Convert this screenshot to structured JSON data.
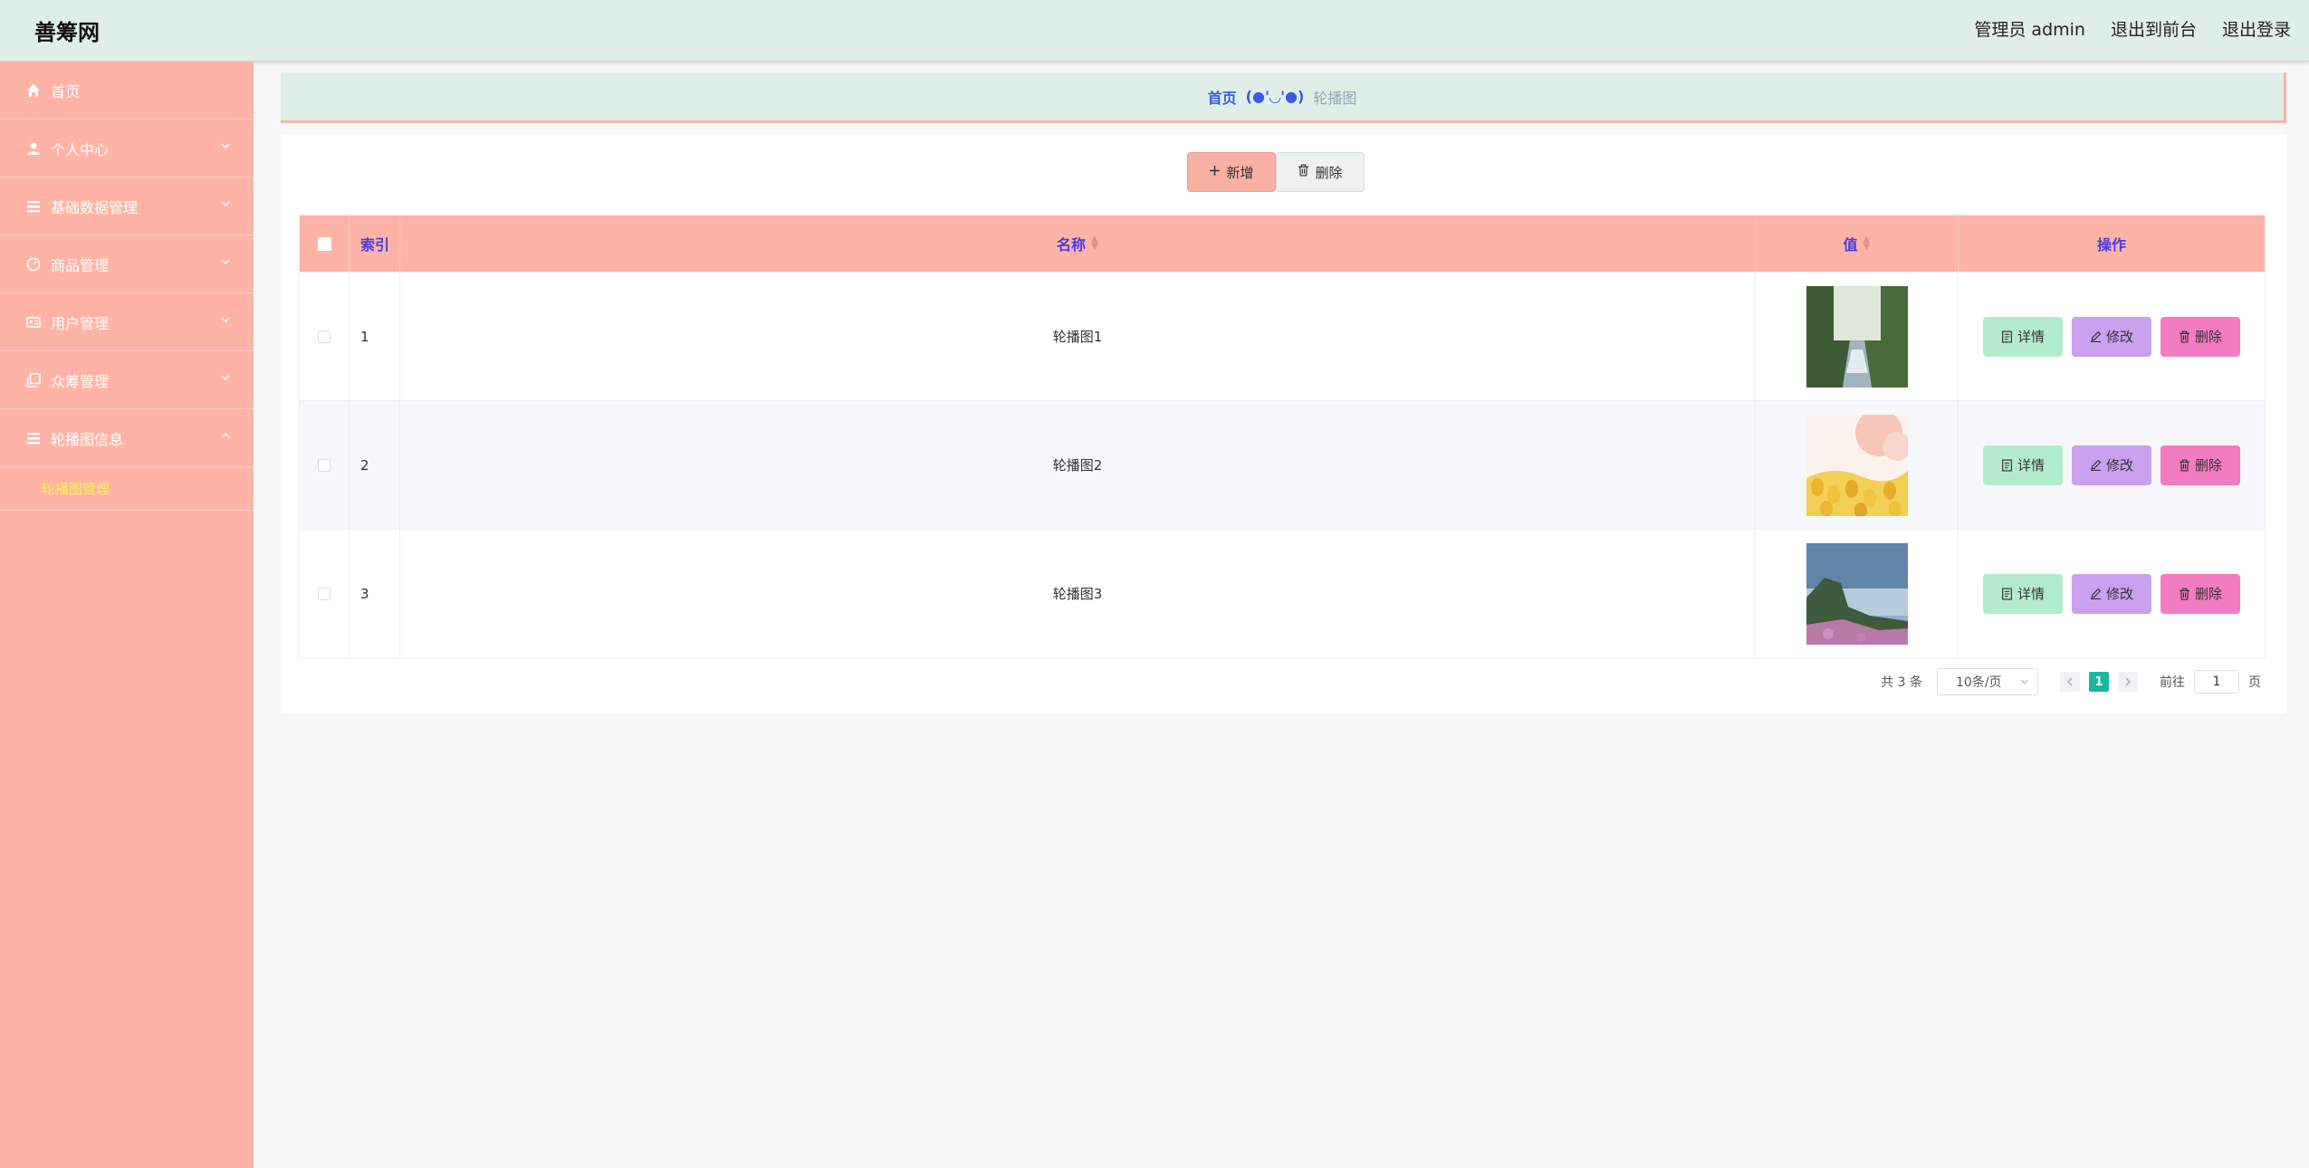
{
  "header": {
    "brand": "善筹网",
    "admin_label": "管理员 admin",
    "front_link": "退出到前台",
    "logout_link": "退出登录"
  },
  "sidebar": {
    "items": [
      {
        "label": "首页",
        "icon": "home-icon"
      },
      {
        "label": "个人中心",
        "icon": "user-icon"
      },
      {
        "label": "基础数据管理",
        "icon": "list-icon"
      },
      {
        "label": "商品管理",
        "icon": "dashboard-icon"
      },
      {
        "label": "用户管理",
        "icon": "id-card-icon"
      },
      {
        "label": "众筹管理",
        "icon": "copy-icon"
      },
      {
        "label": "轮播图信息",
        "icon": "list-icon"
      }
    ],
    "submenu": "轮播图管理"
  },
  "breadcrumb": {
    "home": "首页",
    "separator": "(●'◡'●)",
    "current": "轮播图"
  },
  "toolbar": {
    "add_label": "新增",
    "delete_label": "删除"
  },
  "table": {
    "headers": {
      "index": "索引",
      "name": "名称",
      "value": "值",
      "operation": "操作"
    },
    "rows": [
      {
        "index": "1",
        "name": "轮播图1",
        "thumb": "river-forest"
      },
      {
        "index": "2",
        "name": "轮播图2",
        "thumb": "tulip-field"
      },
      {
        "index": "3",
        "name": "轮播图3",
        "thumb": "sea-cliff"
      }
    ],
    "row_actions": {
      "detail": "详情",
      "edit": "修改",
      "delete": "删除"
    }
  },
  "pagination": {
    "total": "共 3 条",
    "page_size": "10条/页",
    "current_page": "1",
    "goto_label": "前往",
    "goto_value": "1",
    "page_suffix": "页"
  },
  "colors": {
    "header_bg": "#dfeee6",
    "sidebar_bg": "#ffb3a6",
    "table_head_bg": "#ffb3a6",
    "header_text": "#4a3be0",
    "active_submenu": "#f2f24a",
    "pager_active": "#16b8a0",
    "detail_btn": "#b3eccd",
    "edit_btn": "#c9a1ee",
    "delete_btn": "#f37cc0"
  }
}
